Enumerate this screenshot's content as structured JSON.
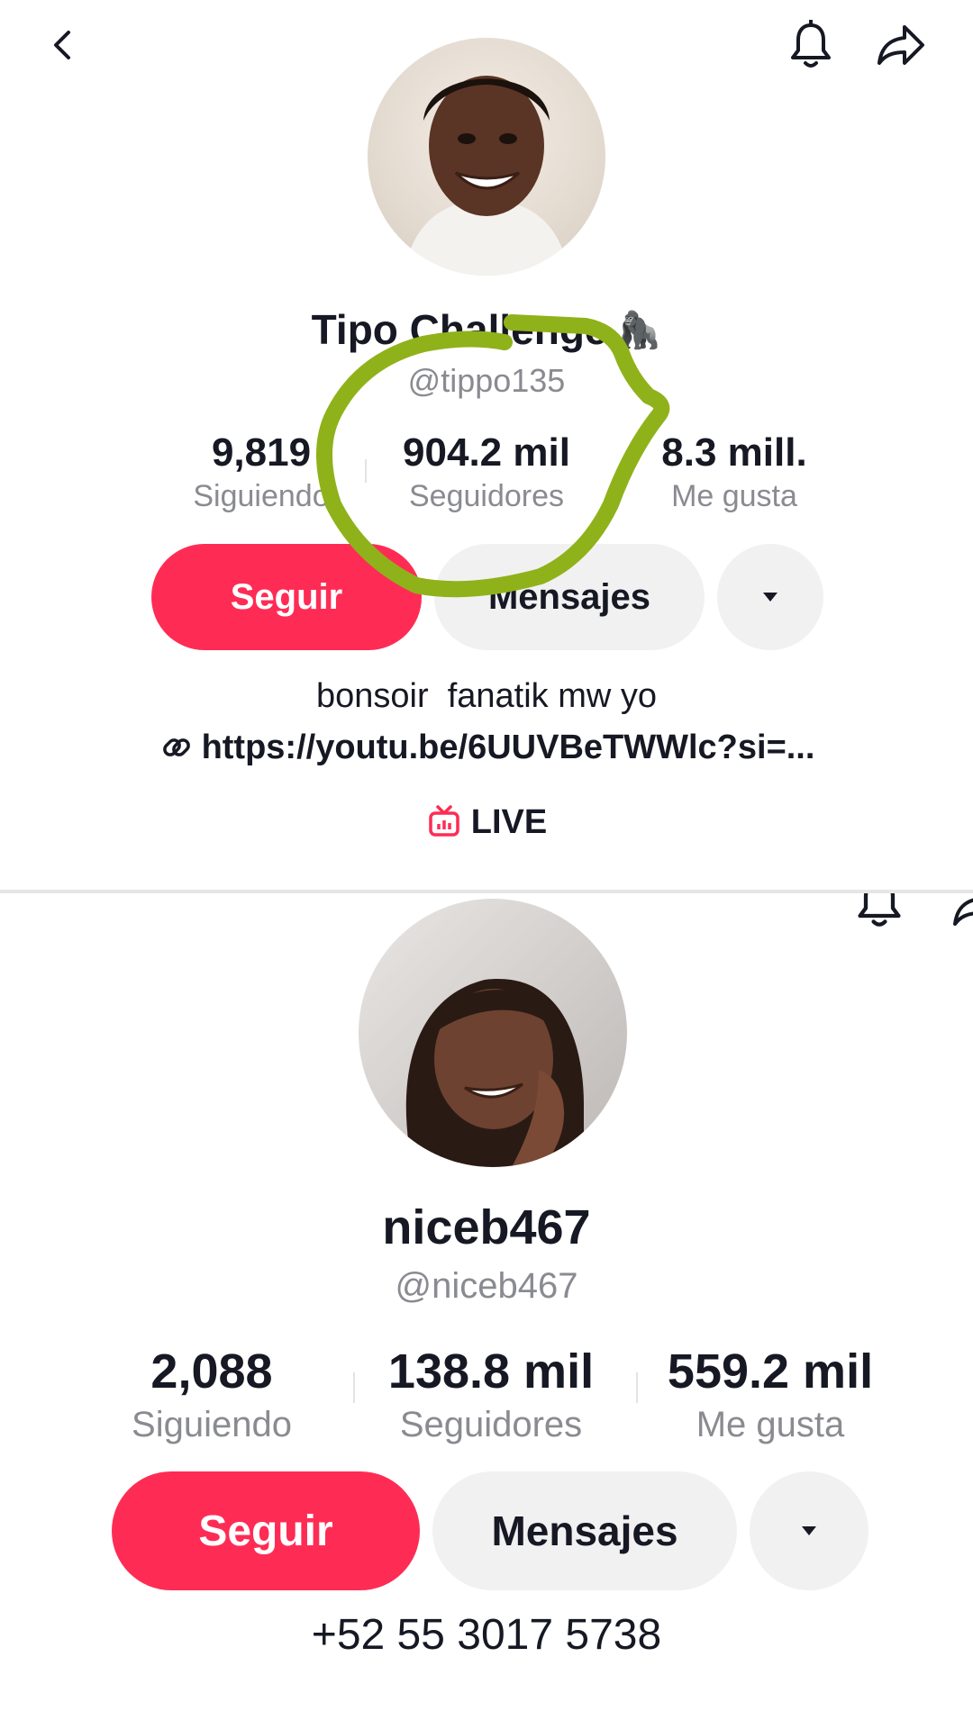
{
  "profile1": {
    "display_name": "Tipo Challenge",
    "name_emoji": "🦍",
    "handle": "@tippo135",
    "stats": [
      {
        "value": "9,819",
        "label": "Siguiendo"
      },
      {
        "value": "904.2 mil",
        "label": "Seguidores"
      },
      {
        "value": "8.3 mill.",
        "label": "Me gusta"
      }
    ],
    "follow_label": "Seguir",
    "message_label": "Mensajes",
    "bio": "bonsoir  fanatik mw yo",
    "link": "https://youtu.be/6UUVBeTWWlc?si=...",
    "live_label": "LIVE"
  },
  "profile2": {
    "display_name": "niceb467",
    "handle": "@niceb467",
    "stats": [
      {
        "value": "2,088",
        "label": "Siguiendo"
      },
      {
        "value": "138.8 mil",
        "label": "Seguidores"
      },
      {
        "value": "559.2 mil",
        "label": "Me gusta"
      }
    ],
    "follow_label": "Seguir",
    "message_label": "Mensajes",
    "phone": "+52 55 3017 5738"
  },
  "colors": {
    "accent": "#fe2c55",
    "annotation": "#8fb21a",
    "secondary_text": "#8a8b91",
    "button_bg": "#f1f1f2"
  },
  "icons": [
    "back-icon",
    "bell-icon",
    "share-icon",
    "link-icon",
    "live-tv-icon",
    "caret-down-icon"
  ]
}
